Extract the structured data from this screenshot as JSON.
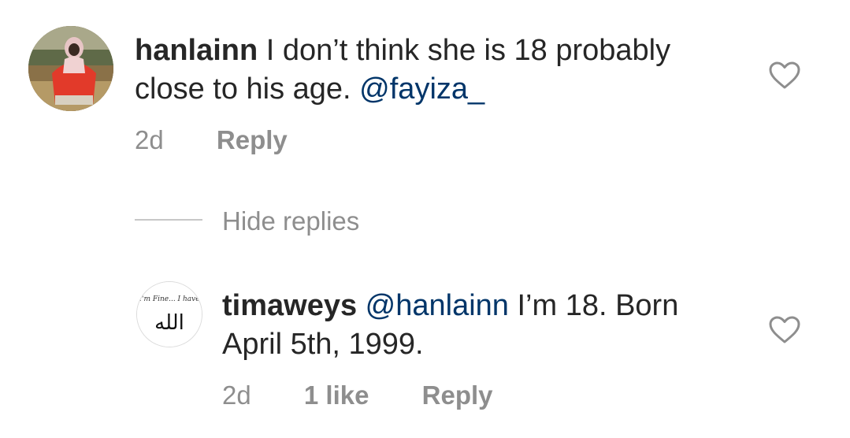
{
  "comments": [
    {
      "username": "hanlainn",
      "text": " I don’t think she is 18 probably close to his age. ",
      "mention": "@fayiza_",
      "time": "2d",
      "reply_label": "Reply"
    },
    {
      "username": "timaweys",
      "mention": "@hanlainn",
      "text": " I’m 18. Born April 5th, 1999.",
      "time": "2d",
      "likes_label": "1 like",
      "reply_label": "Reply",
      "avatar_caption": "I'm Fine... I have",
      "avatar_arabic": "الله"
    }
  ],
  "replies_toggle": {
    "label": "Hide replies"
  },
  "colors": {
    "text": "#262626",
    "mention": "#003569",
    "secondary": "#8e8e8e",
    "divider": "#c7c7c7"
  },
  "icons": {
    "like": "heart-outline-icon"
  }
}
